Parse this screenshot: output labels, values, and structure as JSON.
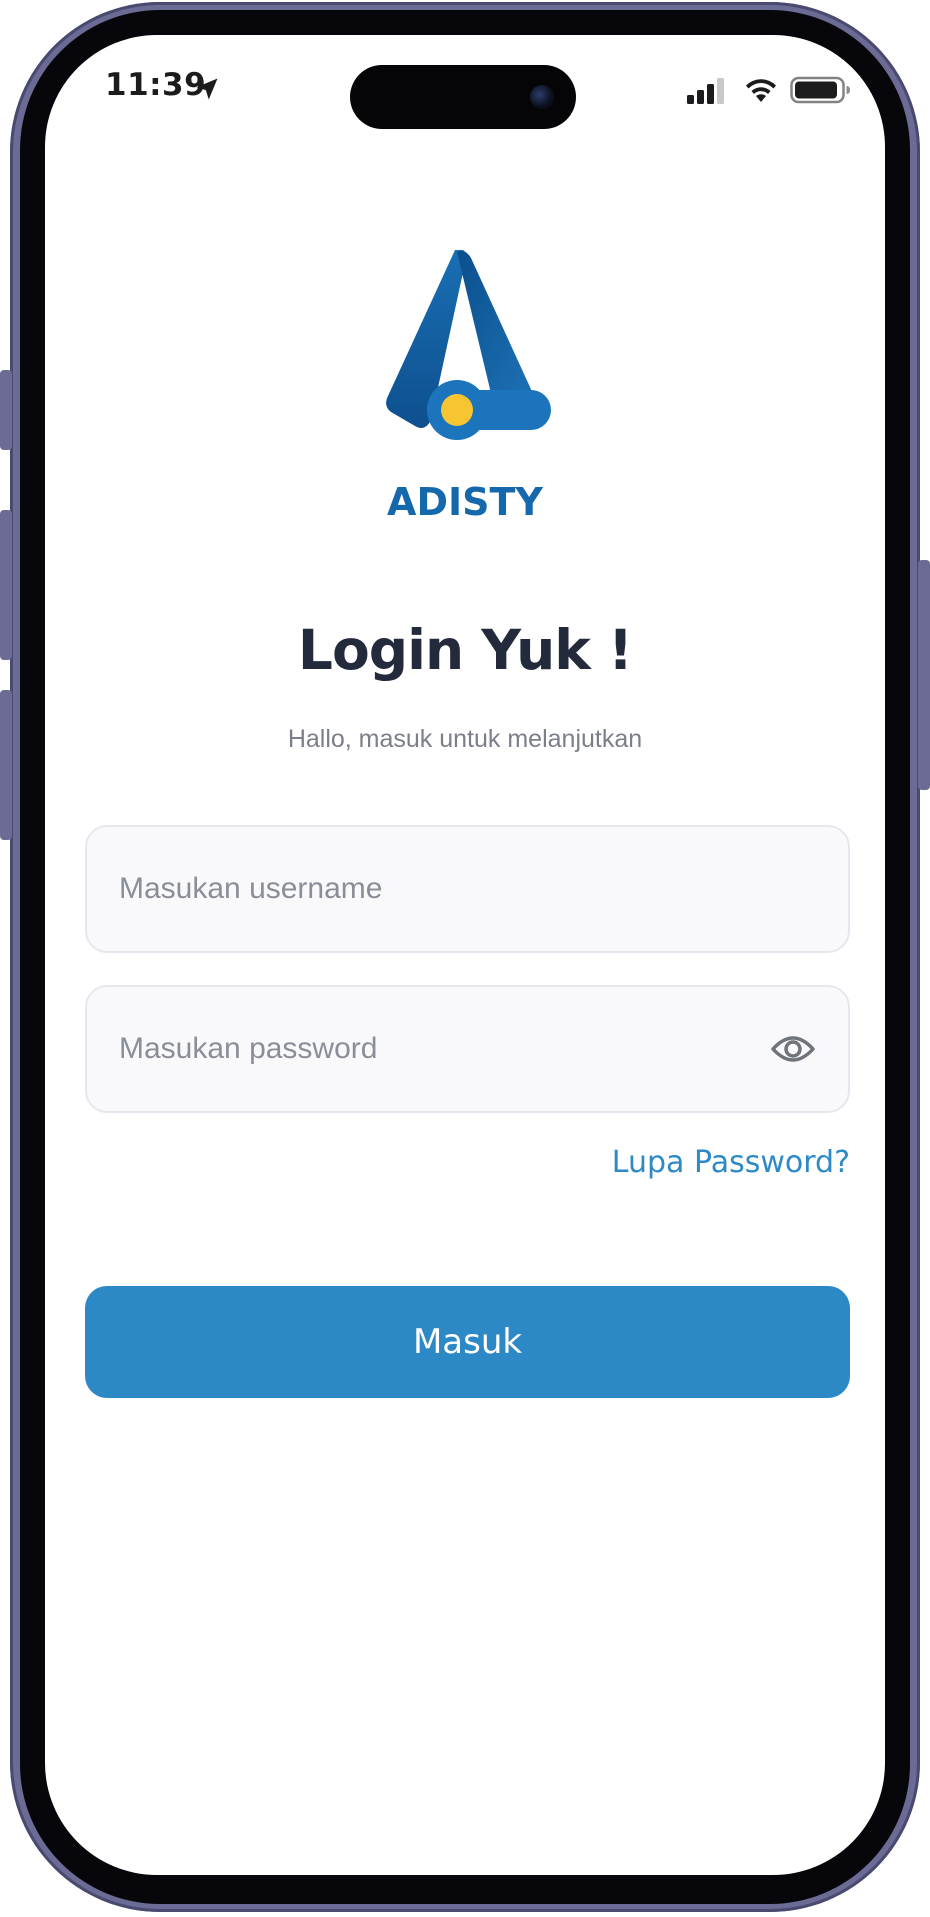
{
  "status_bar": {
    "time": "11:39",
    "icons": [
      "location-arrow-icon",
      "cellular-signal-icon",
      "wifi-icon",
      "battery-icon"
    ]
  },
  "brand": {
    "name": "ADISTY",
    "logo_icon": "adisty-logo",
    "colors": {
      "primary_blue": "#1668ad",
      "accent_yellow": "#f7c531"
    }
  },
  "login": {
    "title": "Login Yuk !",
    "subtitle": "Hallo, masuk untuk melanjutkan",
    "username_placeholder": "Masukan username",
    "password_placeholder": "Masukan password",
    "password_toggle_icon": "eye-icon",
    "forgot_password": "Lupa Password?",
    "submit_label": "Masuk"
  },
  "theme": {
    "button_color": "#2d88c6",
    "link_color": "#2e8ac6",
    "title_color": "#232a3b"
  }
}
